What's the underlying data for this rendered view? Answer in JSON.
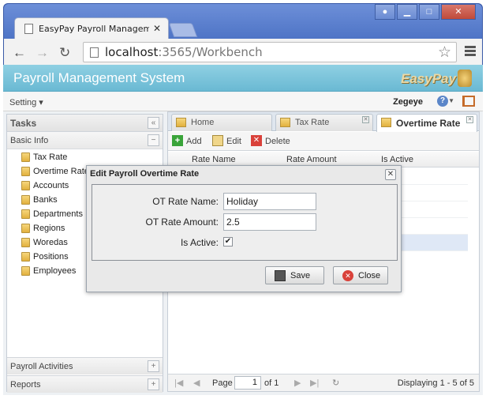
{
  "browser": {
    "tab_title": "EasyPay Payroll Managemen",
    "url_host": "localhost",
    "url_rest": ":3565/Workbench",
    "window_buttons": [
      "user-icon",
      "minimize-icon",
      "maximize-icon",
      "close-icon"
    ]
  },
  "app": {
    "title": "Payroll Management System",
    "logo_text": "EasyPay",
    "setting_label": "Setting ▾",
    "user_name": "Zegeye",
    "help_glyph": "?"
  },
  "sidebar": {
    "title": "Tasks",
    "collapse_glyph": "«",
    "sections": [
      {
        "label": "Basic Info",
        "toggle": "−"
      },
      {
        "label": "Payroll Activities",
        "toggle": "+"
      },
      {
        "label": "Reports",
        "toggle": "+"
      }
    ],
    "items": [
      {
        "label": "Tax Rate"
      },
      {
        "label": "Overtime Rate"
      },
      {
        "label": "Accounts"
      },
      {
        "label": "Banks"
      },
      {
        "label": "Departments"
      },
      {
        "label": "Regions"
      },
      {
        "label": "Woredas"
      },
      {
        "label": "Positions"
      },
      {
        "label": "Employees"
      }
    ]
  },
  "main": {
    "tabs": [
      {
        "label": "Home",
        "closable": false
      },
      {
        "label": "Tax Rate",
        "closable": true
      },
      {
        "label": "Overtime Rate",
        "closable": true,
        "active": true
      }
    ],
    "toolbar": {
      "add": "Add",
      "edit": "Edit",
      "delete": "Delete"
    },
    "columns": [
      "Rate Name",
      "Rate Amount",
      "Is Active"
    ],
    "pager": {
      "page_label": "Page",
      "page_value": "1",
      "of_label": "of 1",
      "display_text": "Displaying 1 - 5 of 5"
    }
  },
  "dialog": {
    "title": "Edit Payroll Overtime Rate",
    "close_glyph": "✕",
    "fields": {
      "name_label": "OT Rate Name:",
      "name_value": "Holiday",
      "amount_label": "OT Rate Amount:",
      "amount_value": "2.5",
      "active_label": "Is Active:",
      "active_checked": true
    },
    "save_label": "Save",
    "close_label": "Close"
  },
  "colors": {
    "header_blue": "#6ab9d3",
    "browser_frame": "#4a6fc3",
    "add_green": "#3aa43a",
    "delete_red": "#d9413a"
  }
}
